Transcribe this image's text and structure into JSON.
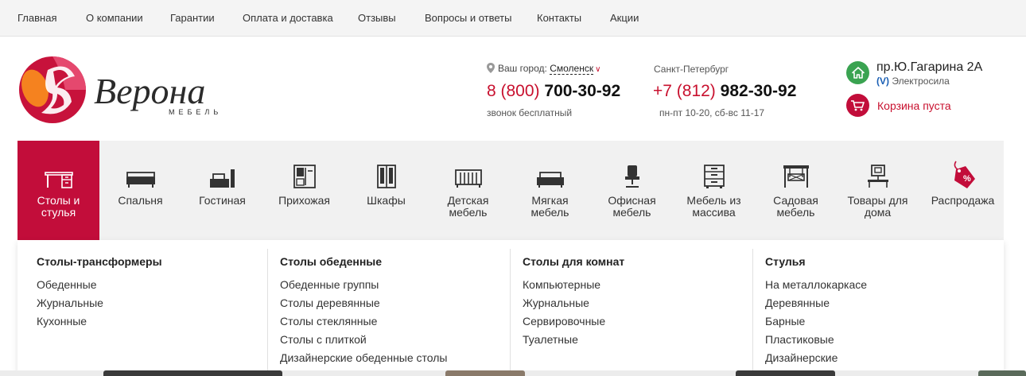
{
  "topnav": {
    "items": [
      "Главная",
      "О компании",
      "Гарантии",
      "Оплата и доставка",
      "Отзывы",
      "Вопросы и ответы",
      "Контакты",
      "Акции"
    ]
  },
  "logo": {
    "name": "Верона",
    "tagline": "МЕБЕЛЬ"
  },
  "location": {
    "label": "Ваш город:",
    "city": "Смоленск"
  },
  "phone1": {
    "code": "8 (800)",
    "number": "700-30-92",
    "note": "звонок бесплатный"
  },
  "phone2": {
    "city": "Санкт-Петербург",
    "code": "+7 (812)",
    "number": "982-30-92",
    "hours": "пн-пт 10-20, сб-вс 11-17"
  },
  "store": {
    "address": "пр.Ю.Гагарина 2А",
    "metro": "Электросила",
    "cart": "Корзина пуста"
  },
  "colors": {
    "accent": "#c20d3a",
    "green": "#3aa351",
    "metro": "#1a5fb4"
  },
  "categories": [
    {
      "label": "Столы и стулья",
      "icon": "table-icon",
      "active": true
    },
    {
      "label": "Спальня",
      "icon": "bed-icon"
    },
    {
      "label": "Гостиная",
      "icon": "tv-stand-icon"
    },
    {
      "label": "Прихожая",
      "icon": "hallway-icon"
    },
    {
      "label": "Шкафы",
      "icon": "wardrobe-icon"
    },
    {
      "label": "Детская мебель",
      "icon": "crib-icon"
    },
    {
      "label": "Мягкая мебель",
      "icon": "sofa-icon"
    },
    {
      "label": "Офисная мебель",
      "icon": "office-chair-icon"
    },
    {
      "label": "Мебель из массива",
      "icon": "dresser-icon"
    },
    {
      "label": "Садовая мебель",
      "icon": "garden-swing-icon"
    },
    {
      "label": "Товары для дома",
      "icon": "home-goods-icon"
    },
    {
      "label": "Распродажа",
      "icon": "sale-tag-icon"
    }
  ],
  "dropdown": {
    "columns": [
      {
        "title": "Столы-трансформеры",
        "items": [
          "Обеденные",
          "Журнальные",
          "Кухонные"
        ]
      },
      {
        "title": "Столы обеденные",
        "items": [
          "Обеденные группы",
          "Столы деревянные",
          "Столы стеклянные",
          "Столы с плиткой",
          "Дизайнерские обеденные столы"
        ]
      },
      {
        "title": "Столы для комнат",
        "items": [
          "Компьютерные",
          "Журнальные",
          "Сервировочные",
          "Туалетные"
        ]
      },
      {
        "title": "Стулья",
        "items": [
          "На металлокаркасе",
          "Деревянные",
          "Барные",
          "Пластиковые",
          "Дизайнерские"
        ]
      }
    ]
  }
}
